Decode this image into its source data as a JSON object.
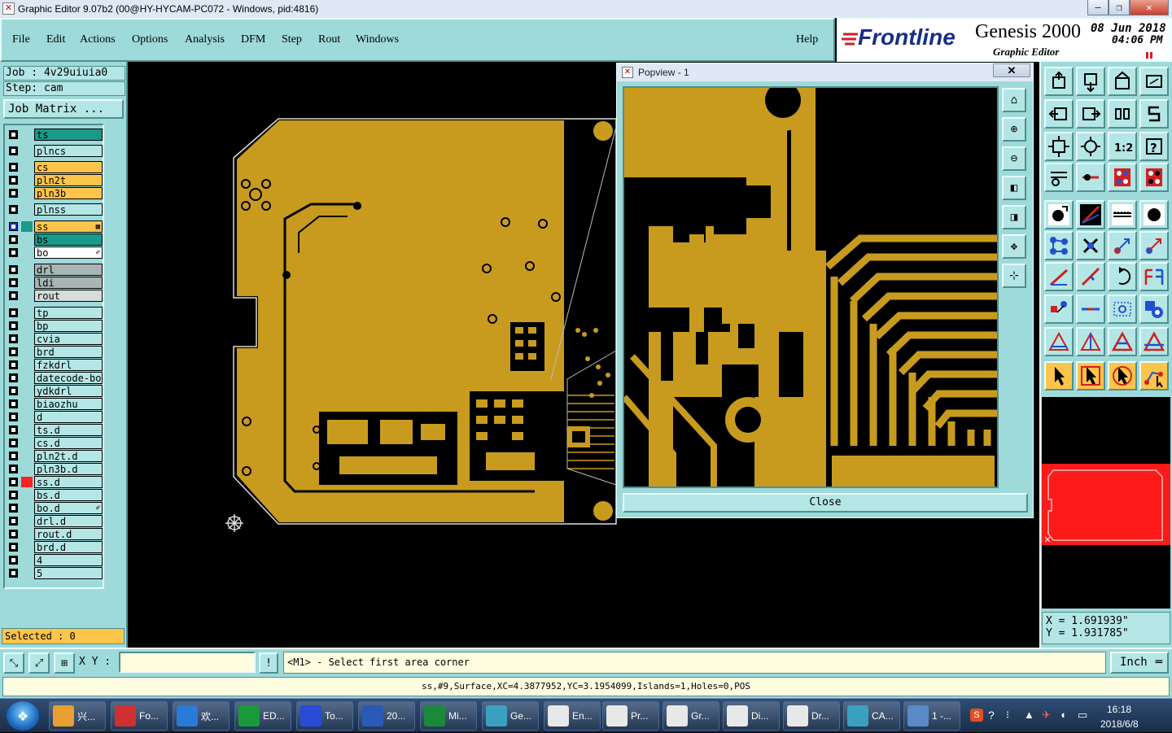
{
  "window": {
    "title": "Graphic Editor 9.07b2 (00@HY-HYCAM-PC072 - Windows, pid:4816)",
    "minimize": "—",
    "restore": "❐",
    "close": "✕"
  },
  "menu": {
    "items": [
      "File",
      "Edit",
      "Actions",
      "Options",
      "Analysis",
      "DFM",
      "Step",
      "Rout",
      "Windows"
    ],
    "help": "Help"
  },
  "brand": {
    "logo": "Frontline",
    "product": "Genesis 2000",
    "subtitle": "Graphic Editor",
    "date": "08 Jun 2018",
    "time": "04:06 PM",
    "colors": {
      "logo_red": "#d0202a",
      "logo_blue": "#1a2d8a"
    }
  },
  "job": {
    "job_line": "Job : 4v29uiuia0",
    "step_line": "Step: cam",
    "matrix_button": "Job Matrix ..."
  },
  "layers": [
    {
      "name": "ts",
      "color": "#1a9a8a",
      "sw": ""
    },
    {
      "name": "plncs",
      "color": "#b4e6e6",
      "sw": ""
    },
    {
      "name": "cs",
      "color": "#ffc44a",
      "sw": ""
    },
    {
      "name": "pln2t",
      "color": "#ffc44a",
      "sw": ""
    },
    {
      "name": "pln3b",
      "color": "#ffc44a",
      "sw": ""
    },
    {
      "name": "plnss",
      "color": "#b4e6e6",
      "sw": ""
    },
    {
      "name": "ss",
      "color": "#ffc44a",
      "sw": "#1a9a8a",
      "tag": "▦",
      "active": true
    },
    {
      "name": "bs",
      "color": "#1a9a8a",
      "sw": ""
    },
    {
      "name": "bo",
      "color": "#ffffff",
      "sw": "",
      "tag": "✐"
    },
    {
      "name": "drl",
      "color": "#a9b4b4",
      "sw": ""
    },
    {
      "name": "ldi",
      "color": "#a9b4b4",
      "sw": ""
    },
    {
      "name": "rout",
      "color": "#d4dcdc",
      "sw": ""
    },
    {
      "name": "tp",
      "color": "#b4e6e6",
      "sw": ""
    },
    {
      "name": "bp",
      "color": "#b4e6e6",
      "sw": ""
    },
    {
      "name": "cvia",
      "color": "#b4e6e6",
      "sw": ""
    },
    {
      "name": "brd",
      "color": "#b4e6e6",
      "sw": ""
    },
    {
      "name": "fzkdrl",
      "color": "#b4e6e6",
      "sw": ""
    },
    {
      "name": "datecode-bo",
      "color": "#b4e6e6",
      "sw": ""
    },
    {
      "name": "ydkdrl",
      "color": "#b4e6e6",
      "sw": ""
    },
    {
      "name": "biaozhu",
      "color": "#b4e6e6",
      "sw": ""
    },
    {
      "name": "d",
      "color": "#b4e6e6",
      "sw": ""
    },
    {
      "name": "ts.d",
      "color": "#b4e6e6",
      "sw": ""
    },
    {
      "name": "cs.d",
      "color": "#b4e6e6",
      "sw": ""
    },
    {
      "name": "pln2t.d",
      "color": "#b4e6e6",
      "sw": ""
    },
    {
      "name": "pln3b.d",
      "color": "#b4e6e6",
      "sw": ""
    },
    {
      "name": "ss.d",
      "color": "#b4e6e6",
      "sw": "#ff2020"
    },
    {
      "name": "bs.d",
      "color": "#b4e6e6",
      "sw": ""
    },
    {
      "name": "bo.d",
      "color": "#b4e6e6",
      "sw": "",
      "tag": "✐"
    },
    {
      "name": "drl.d",
      "color": "#b4e6e6",
      "sw": ""
    },
    {
      "name": "rout.d",
      "color": "#b4e6e6",
      "sw": ""
    },
    {
      "name": "brd.d",
      "color": "#b4e6e6",
      "sw": ""
    },
    {
      "name": "4",
      "color": "#b4e6e6",
      "sw": ""
    },
    {
      "name": "5",
      "color": "#b4e6e6",
      "sw": ""
    }
  ],
  "selected": "Selected : 0",
  "popview": {
    "title": "Popview - 1",
    "close_x": "✕",
    "close_button": "Close"
  },
  "coords": {
    "x": "X = 1.691939\"",
    "y": "Y = 1.931785\""
  },
  "command": {
    "xy_label": "X Y :",
    "xy_value": "",
    "alert": "!",
    "prompt": "<M1> - Select first area corner",
    "units": "Inch"
  },
  "status": "ss,#9,Surface,XC=4.3877952,YC=3.1954099,Islands=1,Holes=0,POS",
  "taskbar": {
    "items": [
      {
        "label": "兴...",
        "icon": "#e8a030"
      },
      {
        "label": "Fo...",
        "icon": "#d03030"
      },
      {
        "label": "欢...",
        "icon": "#2a7ad8"
      },
      {
        "label": "ED...",
        "icon": "#1a9a3a"
      },
      {
        "label": "To...",
        "icon": "#2a4ad8"
      },
      {
        "label": "20...",
        "icon": "#2a5ab8"
      },
      {
        "label": "Mi...",
        "icon": "#1a8a3a"
      },
      {
        "label": "Ge...",
        "icon": "#3aa0c0"
      },
      {
        "label": "En...",
        "icon": "#e8e8e8"
      },
      {
        "label": "Pr...",
        "icon": "#e8e8e8"
      },
      {
        "label": "Gr...",
        "icon": "#e8e8e8"
      },
      {
        "label": "Di...",
        "icon": "#e8e8e8"
      },
      {
        "label": "Dr...",
        "icon": "#e8e8e8"
      },
      {
        "label": "CA...",
        "icon": "#3aa0c0"
      },
      {
        "label": "1 -...",
        "icon": "#5a8ac8"
      }
    ],
    "time": "16:18",
    "date": "2018/6/8"
  },
  "colors": {
    "copper": "#c89b1e",
    "panel": "#9fdada",
    "canvas": "#000000",
    "overview_board": "#ff1a1a"
  }
}
